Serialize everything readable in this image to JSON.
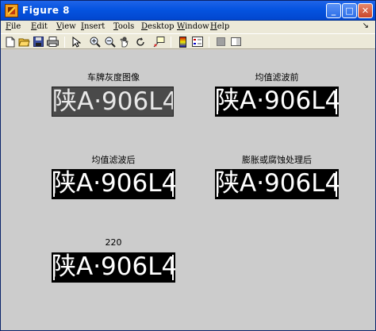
{
  "window": {
    "title": "Figure 8"
  },
  "titlebar_buttons": {
    "minimize": "_",
    "maximize": "□",
    "close": "✕"
  },
  "menu": {
    "items": [
      {
        "first": "F",
        "rest": "ile"
      },
      {
        "first": "E",
        "rest": "dit"
      },
      {
        "first": "V",
        "rest": "iew"
      },
      {
        "first": "I",
        "rest": "nsert"
      },
      {
        "first": "T",
        "rest": "ools"
      },
      {
        "first": "D",
        "rest": "esktop"
      },
      {
        "first": "W",
        "rest": "indow"
      },
      {
        "first": "H",
        "rest": "elp"
      }
    ],
    "overflow": "↘"
  },
  "toolbar": {
    "icons": [
      "new-file-icon",
      "open-folder-icon",
      "save-icon",
      "print-icon",
      "pointer-icon",
      "zoom-in-icon",
      "zoom-out-icon",
      "pan-icon",
      "rotate-icon",
      "data-cursor-icon",
      "colorbar-icon",
      "legend-icon",
      "hide-plot-tools-icon",
      "show-plot-tools-icon"
    ]
  },
  "figure": {
    "subplots": [
      {
        "title": "车牌灰度图像",
        "plate_text": "陕A·906L4",
        "style": "gray"
      },
      {
        "title": "均值滤波前",
        "plate_text": "陕A·906L4",
        "style": "binary"
      },
      {
        "title": "均值滤波后",
        "plate_text": "陕A·906L4",
        "style": "binary"
      },
      {
        "title": "膨胀或腐蚀处理后",
        "plate_text": "陕A·906L4",
        "style": "binary"
      },
      {
        "title": "220",
        "plate_text": "陕A·906L4",
        "style": "binary"
      }
    ]
  },
  "colors": {
    "titlebar": "#0554e0",
    "figure_bg": "#cccccc",
    "menu_bg": "#ece9d8"
  }
}
